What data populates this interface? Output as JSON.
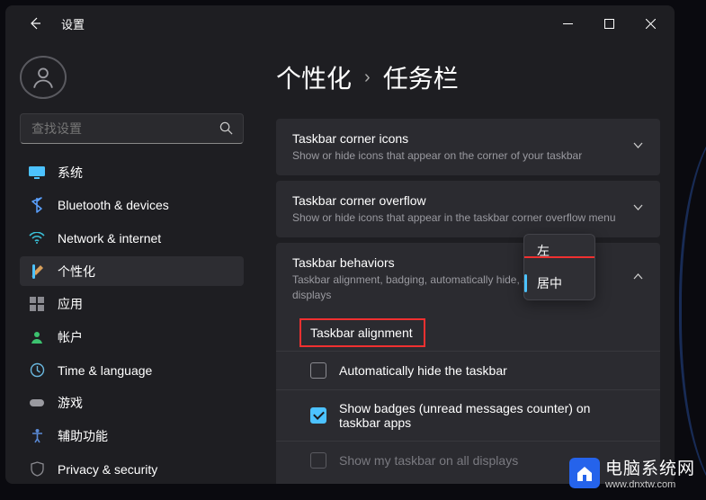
{
  "window": {
    "title": "设置"
  },
  "search": {
    "placeholder": "查找设置"
  },
  "nav": {
    "items": [
      {
        "label": "系统"
      },
      {
        "label": "Bluetooth & devices"
      },
      {
        "label": "Network & internet"
      },
      {
        "label": "个性化"
      },
      {
        "label": "应用"
      },
      {
        "label": "帐户"
      },
      {
        "label": "Time & language"
      },
      {
        "label": "游戏"
      },
      {
        "label": "辅助功能"
      },
      {
        "label": "Privacy & security"
      }
    ]
  },
  "breadcrumb": {
    "parent": "个性化",
    "current": "任务栏"
  },
  "panels": {
    "cornerIcons": {
      "title": "Taskbar corner icons",
      "desc": "Show or hide icons that appear on the corner of your taskbar"
    },
    "cornerOverflow": {
      "title": "Taskbar corner overflow",
      "desc": "Show or hide icons that appear in the taskbar corner overflow menu"
    },
    "behaviors": {
      "title": "Taskbar behaviors",
      "desc": "Taskbar alignment, badging, automatically hide, and multiple displays",
      "alignment_label": "Taskbar alignment",
      "auto_hide": "Automatically hide the taskbar",
      "badges": "Show badges (unread messages counter) on taskbar apps",
      "all_displays": "Show my taskbar on all displays"
    }
  },
  "dropdown": {
    "options": [
      {
        "label": "左"
      },
      {
        "label": "居中"
      }
    ]
  },
  "watermark": {
    "cn": "电脑系统网",
    "url": "www.dnxtw.com"
  }
}
